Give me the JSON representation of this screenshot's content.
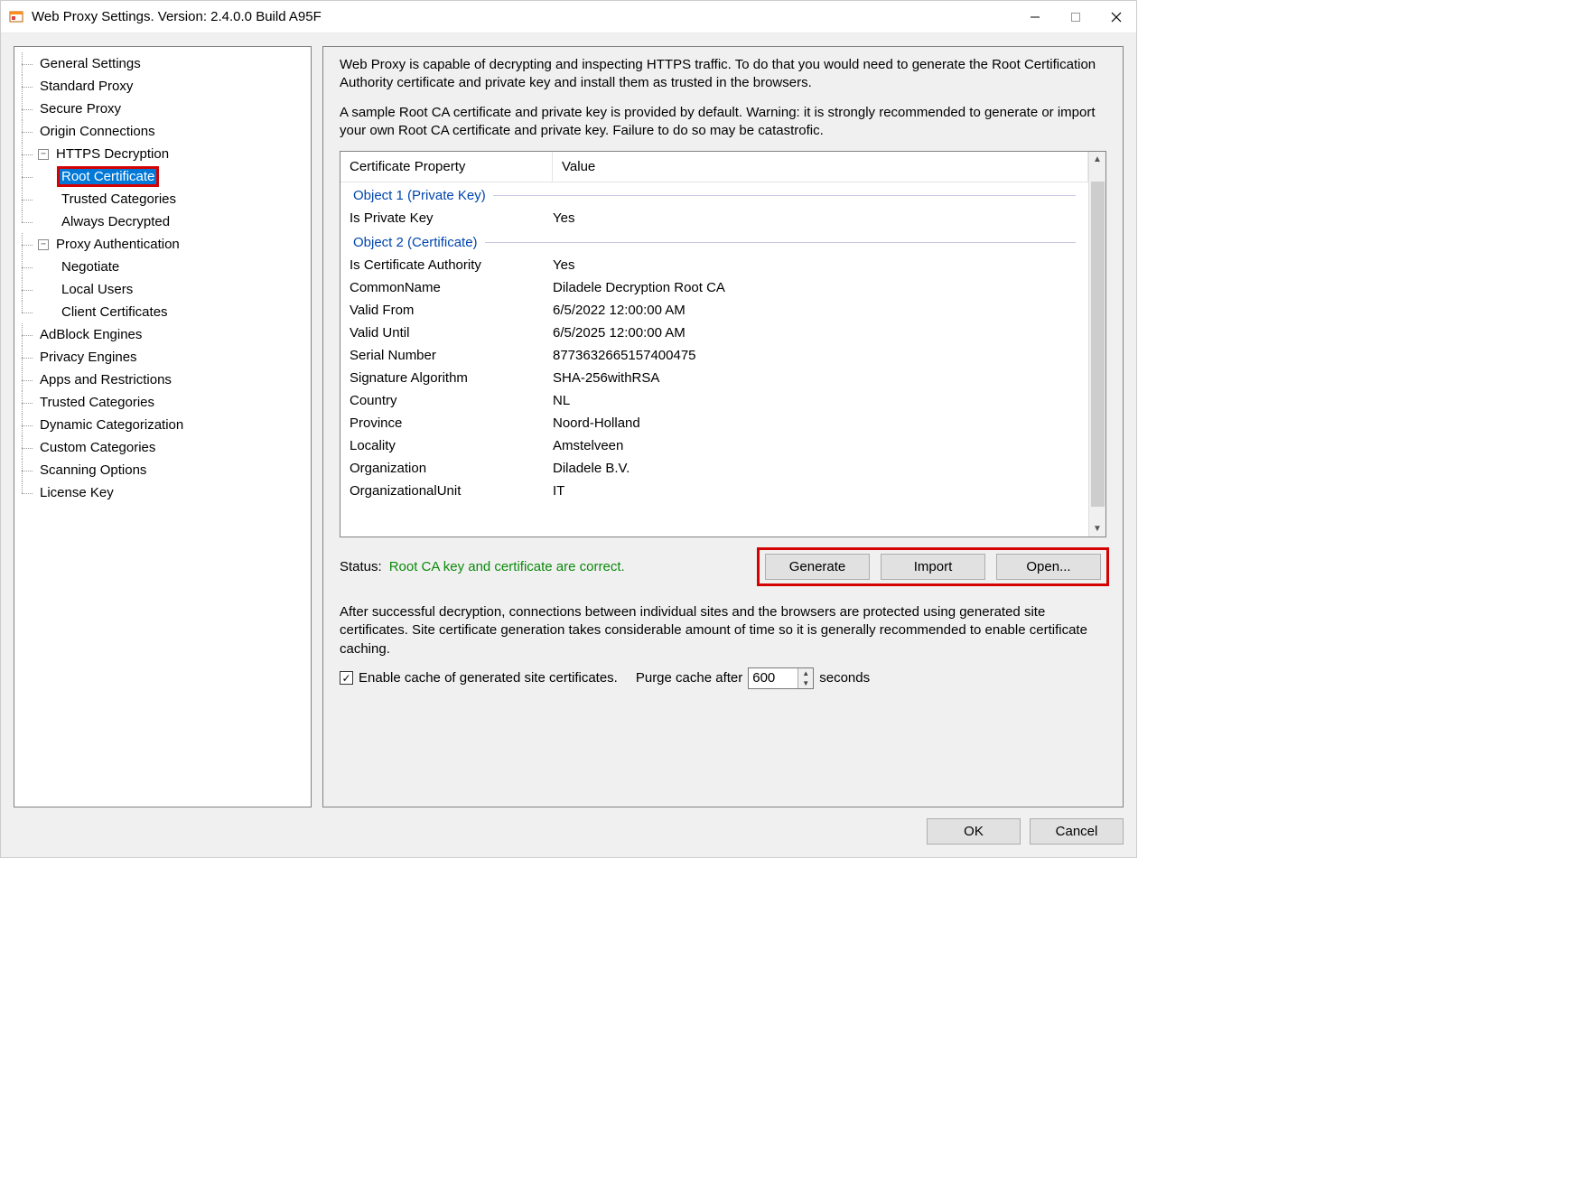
{
  "window": {
    "title": "Web Proxy Settings. Version: 2.4.0.0 Build A95F"
  },
  "tree": {
    "general_settings": "General Settings",
    "standard_proxy": "Standard Proxy",
    "secure_proxy": "Secure Proxy",
    "origin_connections": "Origin Connections",
    "https_decryption": "HTTPS Decryption",
    "root_certificate": "Root Certificate",
    "trusted_categories": "Trusted Categories",
    "always_decrypted": "Always Decrypted",
    "proxy_authentication": "Proxy Authentication",
    "negotiate": "Negotiate",
    "local_users": "Local Users",
    "client_certificates": "Client Certificates",
    "adblock_engines": "AdBlock Engines",
    "privacy_engines": "Privacy Engines",
    "apps_restrictions": "Apps and Restrictions",
    "trusted_categories2": "Trusted Categories",
    "dynamic_categorization": "Dynamic Categorization",
    "custom_categories": "Custom Categories",
    "scanning_options": "Scanning Options",
    "license_key": "License Key"
  },
  "main": {
    "info1": "Web Proxy is capable of decrypting and inspecting HTTPS traffic. To do that you would need to generate the Root Certification Authority certificate and private key and install them as trusted in the browsers.",
    "info2": "A sample Root CA certificate and private key is provided by default. Warning: it is strongly recommended to generate or import your own Root CA certificate and private key. Failure to do so may be catastrofic.",
    "table": {
      "col_prop": "Certificate Property",
      "col_val": "Value",
      "section1": "Object 1 (Private Key)",
      "section2": "Object 2 (Certificate)",
      "rows": {
        "is_private_key": {
          "k": "Is Private Key",
          "v": "Yes"
        },
        "is_ca": {
          "k": "Is Certificate Authority",
          "v": "Yes"
        },
        "cn": {
          "k": "CommonName",
          "v": "Diladele Decryption Root CA"
        },
        "valid_from": {
          "k": "Valid From",
          "v": "6/5/2022 12:00:00 AM"
        },
        "valid_until": {
          "k": "Valid Until",
          "v": "6/5/2025 12:00:00 AM"
        },
        "serial": {
          "k": "Serial Number",
          "v": "8773632665157400475"
        },
        "sigalg": {
          "k": "Signature Algorithm",
          "v": "SHA-256withRSA"
        },
        "country": {
          "k": "Country",
          "v": "NL"
        },
        "province": {
          "k": "Province",
          "v": "Noord-Holland"
        },
        "locality": {
          "k": "Locality",
          "v": "Amstelveen"
        },
        "org": {
          "k": "Organization",
          "v": "Diladele B.V."
        },
        "ou": {
          "k": "OrganizationalUnit",
          "v": "IT"
        }
      }
    },
    "status_label": "Status:",
    "status_value": "Root CA key and certificate are correct.",
    "btn_generate": "Generate",
    "btn_import": "Import",
    "btn_open": "Open...",
    "post_text": "After successful decryption, connections between individual sites and the browsers are protected using generated site certificates. Site certificate generation takes considerable amount of time so it is generally recommended to enable certificate caching.",
    "cache_enable": "Enable cache of generated site certificates.",
    "purge_before": "Purge cache after",
    "purge_value": "600",
    "purge_after": "seconds"
  },
  "dialog": {
    "ok": "OK",
    "cancel": "Cancel"
  }
}
